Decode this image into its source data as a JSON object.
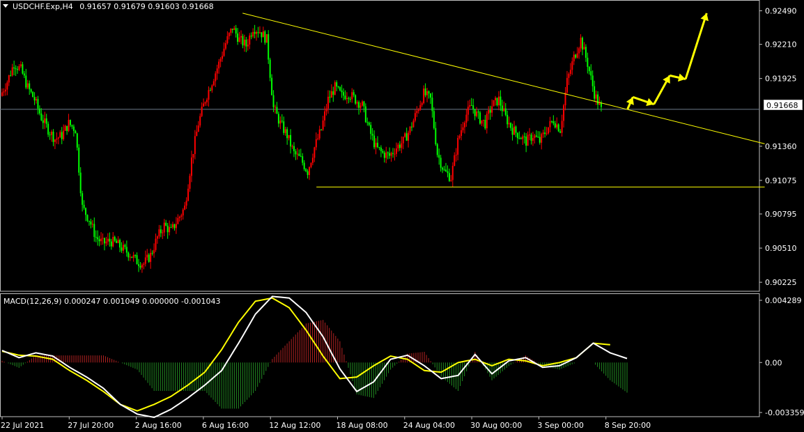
{
  "header": {
    "symbol": "USDCHF.Exp,H4",
    "ohlc": "0.91657 0.91679 0.91603 0.91668"
  },
  "macd_header": "MACD(12,26,9) 0.000247 0.001049 0.000000 -0.001043",
  "current_price_label": "0.91668",
  "price_axis_labels": [
    "0.92490",
    "0.92210",
    "0.91925",
    "0.91668",
    "0.91360",
    "0.91075",
    "0.90795",
    "0.90510",
    "0.90225"
  ],
  "macd_axis_labels": [
    "0.004289",
    "0.00",
    "-0.003359"
  ],
  "time_axis_labels": [
    "22 Jul 2021",
    "27 Jul 20:00",
    "2 Aug 16:00",
    "6 Aug 16:00",
    "12 Aug 12:00",
    "18 Aug 08:00",
    "24 Aug 04:00",
    "30 Aug 00:00",
    "3 Sep 00:00",
    "8 Sep 20:00"
  ],
  "colors": {
    "background": "#000000",
    "bull": "#ff0000",
    "bear": "#00ff00",
    "trendline": "#ffff00",
    "macd_main": "#ffffff",
    "macd_signal": "#ffff00",
    "hist_pos": "#b22222",
    "hist_neg": "#228b22",
    "grid_line": "#ffffff",
    "projection_arrow": "#ffff00"
  },
  "chart_data": {
    "type": "candlestick",
    "title": "USDCHF.Exp,H4",
    "price_range": [
      0.9015,
      0.9258
    ],
    "current_price": 0.91668,
    "price_path": [
      [
        0,
        0.9178
      ],
      [
        4,
        0.919
      ],
      [
        8,
        0.9205
      ],
      [
        12,
        0.92
      ],
      [
        16,
        0.9185
      ],
      [
        20,
        0.9175
      ],
      [
        24,
        0.916
      ],
      [
        28,
        0.915
      ],
      [
        32,
        0.9142
      ],
      [
        36,
        0.9145
      ],
      [
        40,
        0.9155
      ],
      [
        44,
        0.915
      ],
      [
        48,
        0.9085
      ],
      [
        52,
        0.9075
      ],
      [
        56,
        0.906
      ],
      [
        60,
        0.9055
      ],
      [
        64,
        0.9057
      ],
      [
        68,
        0.9055
      ],
      [
        72,
        0.905
      ],
      [
        76,
        0.9046
      ],
      [
        80,
        0.904
      ],
      [
        84,
        0.9038
      ],
      [
        88,
        0.9045
      ],
      [
        92,
        0.906
      ],
      [
        96,
        0.907
      ],
      [
        100,
        0.9065
      ],
      [
        104,
        0.9075
      ],
      [
        108,
        0.9085
      ],
      [
        112,
        0.9125
      ],
      [
        116,
        0.9155
      ],
      [
        120,
        0.9175
      ],
      [
        124,
        0.919
      ],
      [
        128,
        0.9205
      ],
      [
        132,
        0.9222
      ],
      [
        136,
        0.9235
      ],
      [
        140,
        0.9225
      ],
      [
        144,
        0.922
      ],
      [
        148,
        0.9235
      ],
      [
        152,
        0.9232
      ],
      [
        156,
        0.9225
      ],
      [
        160,
        0.9168
      ],
      [
        164,
        0.9155
      ],
      [
        168,
        0.9145
      ],
      [
        172,
        0.913
      ],
      [
        176,
        0.9125
      ],
      [
        180,
        0.9115
      ],
      [
        184,
        0.9135
      ],
      [
        188,
        0.915
      ],
      [
        192,
        0.9175
      ],
      [
        196,
        0.9185
      ],
      [
        200,
        0.9178
      ],
      [
        204,
        0.918
      ],
      [
        208,
        0.9175
      ],
      [
        212,
        0.917
      ],
      [
        216,
        0.915
      ],
      [
        220,
        0.9135
      ],
      [
        224,
        0.913
      ],
      [
        228,
        0.9128
      ],
      [
        232,
        0.9135
      ],
      [
        236,
        0.914
      ],
      [
        240,
        0.915
      ],
      [
        244,
        0.9165
      ],
      [
        248,
        0.918
      ],
      [
        252,
        0.9175
      ],
      [
        256,
        0.913
      ],
      [
        260,
        0.9115
      ],
      [
        264,
        0.911
      ],
      [
        268,
        0.914
      ],
      [
        272,
        0.916
      ],
      [
        276,
        0.917
      ],
      [
        280,
        0.916
      ],
      [
        284,
        0.9155
      ],
      [
        288,
        0.917
      ],
      [
        292,
        0.9175
      ],
      [
        296,
        0.916
      ],
      [
        300,
        0.915
      ],
      [
        304,
        0.9145
      ],
      [
        308,
        0.914
      ],
      [
        312,
        0.9145
      ],
      [
        316,
        0.914
      ],
      [
        320,
        0.915
      ],
      [
        324,
        0.9158
      ],
      [
        328,
        0.915
      ],
      [
        332,
        0.919
      ],
      [
        336,
        0.921
      ],
      [
        340,
        0.9225
      ],
      [
        344,
        0.9205
      ],
      [
        348,
        0.918
      ],
      [
        352,
        0.9166
      ]
    ],
    "trendlines": [
      {
        "type": "descending",
        "from": [
          46,
          0.9247
        ],
        "to": [
          145,
          0.9138
        ]
      },
      {
        "type": "support",
        "from": [
          60,
          0.9102
        ],
        "to": [
          145,
          0.9102
        ]
      }
    ],
    "projection_path": [
      [
        119,
        0.9167
      ],
      [
        120,
        0.9177
      ],
      [
        124,
        0.9171
      ],
      [
        127,
        0.9195
      ],
      [
        130,
        0.9192
      ],
      [
        134,
        0.9247
      ]
    ],
    "macd": {
      "params": "12,26,9",
      "range": [
        -0.003359,
        0.004289
      ],
      "main": [
        [
          0,
          0.00075
        ],
        [
          4,
          0.0003
        ],
        [
          8,
          0.0006
        ],
        [
          12,
          0.0004
        ],
        [
          16,
          -0.0003
        ],
        [
          20,
          -0.0009
        ],
        [
          24,
          -0.0016
        ],
        [
          28,
          -0.0026
        ],
        [
          32,
          -0.0032
        ],
        [
          36,
          -0.0034
        ],
        [
          40,
          -0.0029
        ],
        [
          44,
          -0.0022
        ],
        [
          48,
          -0.0014
        ],
        [
          52,
          -0.0005
        ],
        [
          56,
          0.0012
        ],
        [
          60,
          0.003
        ],
        [
          64,
          0.0041
        ],
        [
          68,
          0.004
        ],
        [
          72,
          0.0031
        ],
        [
          76,
          0.0016
        ],
        [
          80,
          -0.0004
        ],
        [
          84,
          -0.0018
        ],
        [
          88,
          -0.0012
        ],
        [
          92,
          0.0002
        ],
        [
          96,
          0.00045
        ],
        [
          100,
          -0.0002
        ],
        [
          104,
          -0.001
        ],
        [
          108,
          -0.0008
        ],
        [
          112,
          0.0005
        ],
        [
          116,
          -0.0007
        ],
        [
          120,
          0.0001
        ],
        [
          124,
          0.0003
        ],
        [
          128,
          -0.0003
        ],
        [
          132,
          -0.0002
        ],
        [
          136,
          0.0003
        ],
        [
          140,
          0.0012
        ],
        [
          144,
          0.0006
        ],
        [
          148,
          0.00025
        ]
      ],
      "signal": [
        [
          0,
          0.0007
        ],
        [
          4,
          0.00045
        ],
        [
          8,
          0.0004
        ],
        [
          12,
          0.0002
        ],
        [
          16,
          -0.0005
        ],
        [
          20,
          -0.0011
        ],
        [
          24,
          -0.0018
        ],
        [
          28,
          -0.0026
        ],
        [
          32,
          -0.003
        ],
        [
          36,
          -0.0026
        ],
        [
          40,
          -0.0021
        ],
        [
          44,
          -0.0014
        ],
        [
          48,
          -0.0006
        ],
        [
          52,
          0.0008
        ],
        [
          56,
          0.0025
        ],
        [
          60,
          0.0038
        ],
        [
          64,
          0.004
        ],
        [
          68,
          0.0034
        ],
        [
          72,
          0.002
        ],
        [
          76,
          0.0004
        ],
        [
          80,
          -0.001
        ],
        [
          84,
          -0.0009
        ],
        [
          88,
          -0.0002
        ],
        [
          92,
          0.0004
        ],
        [
          96,
          0.0002
        ],
        [
          100,
          -0.0005
        ],
        [
          104,
          -0.0006
        ],
        [
          108,
          0.0
        ],
        [
          112,
          0.0002
        ],
        [
          116,
          -0.0002
        ],
        [
          120,
          0.0002
        ],
        [
          124,
          0.0001
        ],
        [
          128,
          -0.0002
        ],
        [
          132,
          0.0
        ],
        [
          136,
          0.0003
        ],
        [
          140,
          0.0012
        ],
        [
          144,
          0.0011
        ]
      ]
    }
  }
}
